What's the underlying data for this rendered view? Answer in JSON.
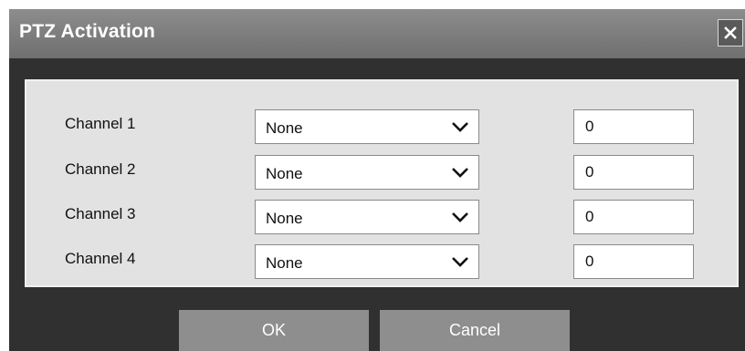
{
  "dialog": {
    "title": "PTZ Activation",
    "close_icon": "close-icon"
  },
  "channels": [
    {
      "label": "Channel 1",
      "selection": "None",
      "value": "0"
    },
    {
      "label": "Channel 2",
      "selection": "None",
      "value": "0"
    },
    {
      "label": "Channel 3",
      "selection": "None",
      "value": "0"
    },
    {
      "label": "Channel 4",
      "selection": "None",
      "value": "0"
    }
  ],
  "buttons": {
    "ok_label": "OK",
    "cancel_label": "Cancel"
  },
  "icons": {
    "dropdown": "chevron-down-icon"
  },
  "colors": {
    "title_bar": "#7d7d7d",
    "dialog_background": "#303030",
    "panel_background": "#e2e2e2",
    "button_background": "#8e8e8e"
  }
}
